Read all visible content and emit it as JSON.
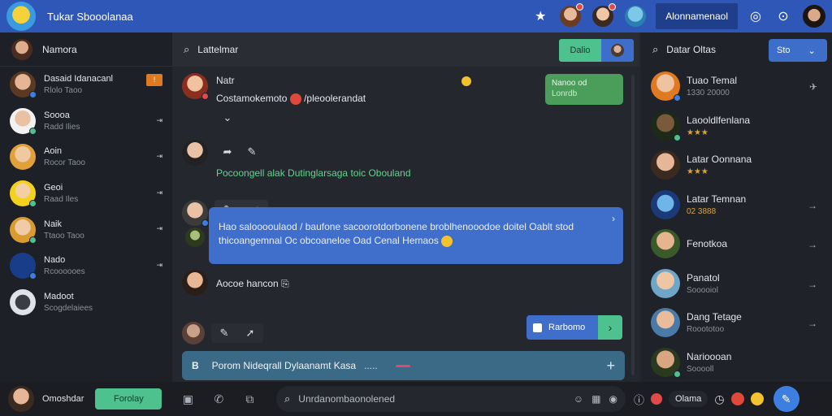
{
  "app": {
    "title": "Tukar Sbooolanaa"
  },
  "top": {
    "profile_name": "Alonnamenaol"
  },
  "left": {
    "header_name": "Namora",
    "contacts": [
      {
        "name": "Dasaid Idanacanl",
        "sub": "Rlolo Taoo",
        "badge": "!"
      },
      {
        "name": "Soooa",
        "sub": "Radd Ilies",
        "meta": "⇥"
      },
      {
        "name": "Aoin",
        "sub": "Rocor Taoo",
        "meta": "⇥"
      },
      {
        "name": "Geoi",
        "sub": "Raad Iles",
        "meta": "⇥"
      },
      {
        "name": "Naik",
        "sub": "Ttaoo Taoo",
        "meta": "⇥"
      },
      {
        "name": "Nado",
        "sub": "Rcoooooes",
        "meta": "⇥"
      },
      {
        "name": "Madoot",
        "sub": "Scogdelaiees"
      }
    ]
  },
  "chat": {
    "title": "Lattelmar",
    "green_button": "Dalio",
    "messages": [
      {
        "author": "Natr",
        "text": "Costamokemoto",
        "text2": "/pleoolerandat"
      },
      {
        "text": "Pocoongell alak Dutinglarsaga toic Obouland"
      },
      {
        "text": "Hao salooooulaod / baufone sacoorotdorbonene broblhenooodoe doitel Oablt stod thicoangemnal Oc obcoaneloe Oad Cenal Hemaos"
      },
      {
        "text": "Aocoe hancon"
      }
    ],
    "green_bubble": {
      "line1": "Nanoo od",
      "line2": "Lonrdb"
    },
    "send_label": "Rarbomo",
    "compose_text": "Porom Nideqrall Dylaanamt Kasa",
    "compose_dots": "....."
  },
  "right": {
    "search_label": "Datar Oltas",
    "button_label": "Sto",
    "items": [
      {
        "name": "Tuao Temal",
        "sub": "1330 20000"
      },
      {
        "name": "Laooldlfenlana",
        "sub": "★★★"
      },
      {
        "name": "Latar Oonnana",
        "sub": "★★★"
      },
      {
        "name": "Latar Temnan",
        "sub": "02 3888"
      },
      {
        "name": "Fenotkoa",
        "sub": ""
      },
      {
        "name": "Panatol",
        "sub": "Sooooiol"
      },
      {
        "name": "Dang Tetage",
        "sub": "Rooototoo"
      },
      {
        "name": "Narioooan",
        "sub": "Sooooll"
      }
    ]
  },
  "bottom": {
    "user_name": "Omoshdar",
    "green_label": "Forolay",
    "search_placeholder": "Unrdanombaonolened",
    "pill_label": "Olama"
  },
  "colors": {
    "accent_blue": "#2e57b8",
    "accent_green": "#4ec28e",
    "bubble_blue": "#3f6fcb",
    "background": "#23262d"
  }
}
